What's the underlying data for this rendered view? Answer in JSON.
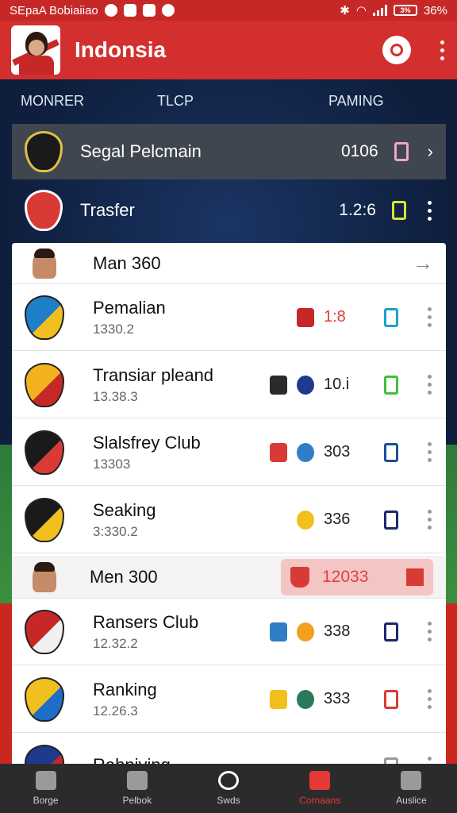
{
  "status_bar": {
    "app_text": "SEpaA Bobiaiiao",
    "battery": "3%",
    "battery_text": "36%"
  },
  "header": {
    "title": "Indonsia"
  },
  "tabs": [
    "MONRER",
    "TLCP",
    "PAMING"
  ],
  "dark_rows": [
    {
      "name": "Segal Pelcmain",
      "value": "0106",
      "tag_color": "#f2a6c6"
    },
    {
      "name": "Trasfer",
      "value": "1.2:6",
      "tag_color": "#d4e63a"
    }
  ],
  "list": {
    "header_row": {
      "title": "Man 360"
    },
    "items": [
      {
        "title": "Pemalian",
        "subtitle": "1330.2",
        "value": "1:8",
        "value_color": "#d9413a",
        "tag_color": "#1fa0c8",
        "crest_colors": [
          "#1e7ec8",
          "#f2c01e"
        ],
        "mini1": "#c62828",
        "mini2": null
      },
      {
        "title": "Transiar pleand",
        "subtitle": "13.38.3",
        "value": "10.i",
        "value_color": "#222",
        "tag_color": "#3fbf3f",
        "crest_colors": [
          "#f2b21e",
          "#c62828"
        ],
        "mini1": "#2a2a2a",
        "mini2": "#1e3a8c"
      },
      {
        "title": "Slalsfrey Club",
        "subtitle": "13303",
        "value": "303",
        "value_color": "#222",
        "tag_color": "#1e4e9c",
        "crest_colors": [
          "#1a1a1a",
          "#d83b35"
        ],
        "mini1": "#d83b35",
        "mini2": "#2f7fc8"
      },
      {
        "title": "Seaking",
        "subtitle": "3:330.2",
        "value": "336",
        "value_color": "#222",
        "tag_color": "#1a2a6a",
        "crest_colors": [
          "#1a1a1a",
          "#f2c01e"
        ],
        "mini1": null,
        "mini2": "#f2c01e"
      },
      {
        "title": "Ransers Club",
        "subtitle": "12.32.2",
        "value": "338",
        "value_color": "#222",
        "tag_color": "#1a2a6a",
        "crest_colors": [
          "#c62828",
          "#f0f0f0"
        ],
        "mini1": "#2f7fc8",
        "mini2": "#f2a01e"
      },
      {
        "title": "Ranking",
        "subtitle": "12.26.3",
        "value": "333",
        "value_color": "#222",
        "tag_color": "#d83b35",
        "crest_colors": [
          "#f2c01e",
          "#1e6ec8"
        ],
        "mini1": "#f2c01e",
        "mini2": "#2a7a5a"
      },
      {
        "title": "Rahniving",
        "subtitle": "",
        "value": "",
        "value_color": "#222",
        "tag_color": "#999",
        "crest_colors": [
          "#1e3a8c",
          "#c62828"
        ],
        "mini1": null,
        "mini2": null
      }
    ],
    "highlight_row": {
      "title": "Men 300",
      "value": "12033"
    }
  },
  "bottom_nav": [
    "Borge",
    "Pelbok",
    "Swds",
    "Cornaans",
    "Auslice"
  ]
}
